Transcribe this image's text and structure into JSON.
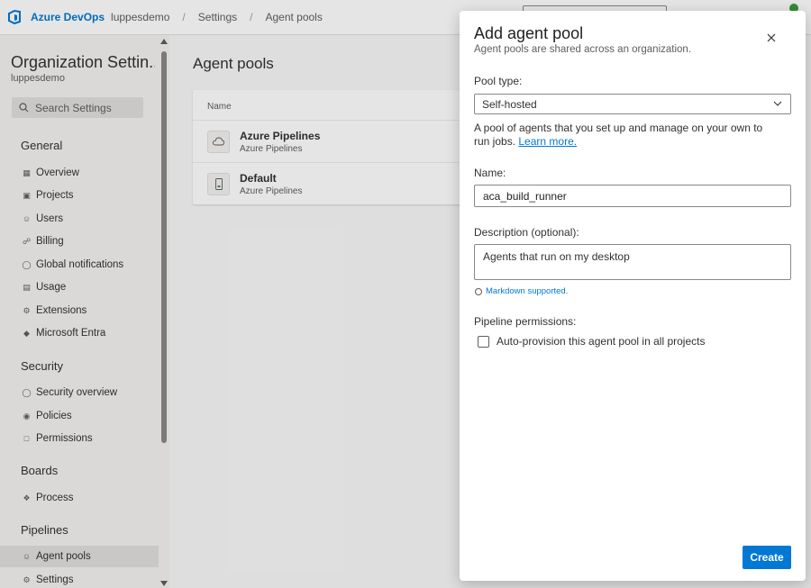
{
  "topbar": {
    "brand": "Azure DevOps",
    "org": "luppesdemo",
    "crumb_settings": "Settings",
    "crumb_agent_pools": "Agent pools",
    "separator": "/"
  },
  "sidebar": {
    "title": "Organization Settin...",
    "subtitle": "luppesdemo",
    "search_placeholder": "Search Settings",
    "sections": {
      "general": "General",
      "security": "Security",
      "boards": "Boards",
      "pipelines": "Pipelines"
    },
    "items": {
      "overview": "Overview",
      "projects": "Projects",
      "users": "Users",
      "billing": "Billing",
      "global_notifications": "Global notifications",
      "usage": "Usage",
      "extensions": "Extensions",
      "microsoft_entra": "Microsoft Entra",
      "security_overview": "Security overview",
      "policies": "Policies",
      "permissions": "Permissions",
      "process": "Process",
      "agent_pools": "Agent pools",
      "settings": "Settings"
    },
    "selected_item": "Agent pools"
  },
  "main": {
    "title": "Agent pools",
    "column_name": "Name",
    "pools": [
      {
        "name": "Azure Pipelines",
        "sub": "Azure Pipelines",
        "icon": "cloud-icon"
      },
      {
        "name": "Default",
        "sub": "Azure Pipelines",
        "icon": "device-icon"
      }
    ]
  },
  "dialog": {
    "title": "Add agent pool",
    "subtitle": "Agent pools are shared across an organization.",
    "pool_type_label": "Pool type:",
    "pool_type_value": "Self-hosted",
    "pool_type_help": "A pool of agents that you set up and manage on your own to run jobs.",
    "learn_more": "Learn more.",
    "name_label": "Name:",
    "name_value": "aca_build_runner",
    "description_label": "Description (optional):",
    "description_value": "Agents that run on my desktop",
    "markdown_note": "Markdown supported.",
    "permissions_label": "Pipeline permissions:",
    "auto_provision_label": "Auto-provision this agent pool in all projects",
    "auto_provision_checked": false,
    "create_label": "Create"
  },
  "colors": {
    "accent": "#0078d4",
    "sidebar_bg": "#f3f2f1",
    "selected_bg": "#e1dfdd"
  }
}
